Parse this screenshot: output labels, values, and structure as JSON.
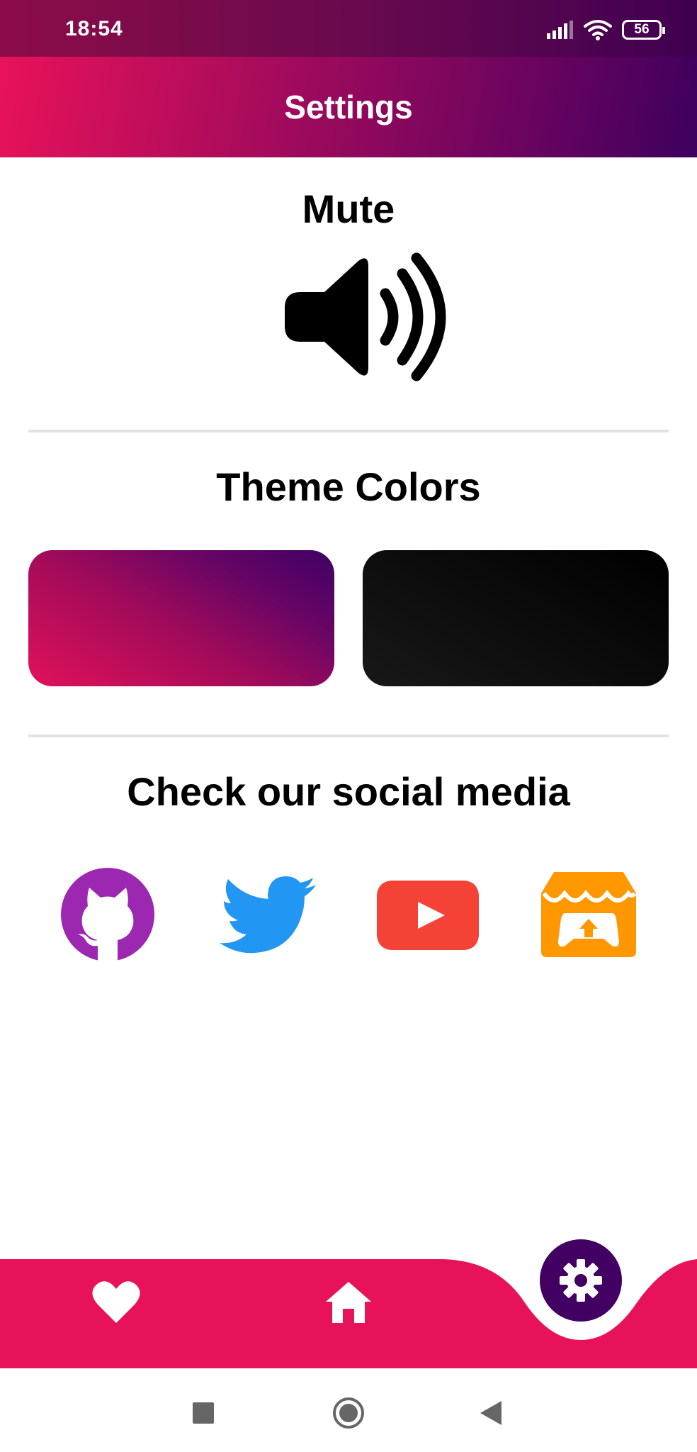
{
  "status_bar": {
    "time": "18:54",
    "battery_level": "56",
    "icons": [
      "signal-icon",
      "wifi-icon",
      "battery-icon"
    ]
  },
  "app_bar": {
    "title": "Settings"
  },
  "mute_section": {
    "title": "Mute",
    "icon": "speaker-volume-icon"
  },
  "theme_section": {
    "title": "Theme Colors",
    "swatches": [
      {
        "name": "gradient-theme",
        "colors": [
          "#e2115a",
          "#3e0065"
        ]
      },
      {
        "name": "black-theme",
        "colors": [
          "#181818",
          "#000000"
        ]
      }
    ]
  },
  "social_section": {
    "title": "Check our social media",
    "links": [
      {
        "name": "github",
        "icon": "github-icon",
        "color": "#9c27b0"
      },
      {
        "name": "twitter",
        "icon": "twitter-icon",
        "color": "#2196f3"
      },
      {
        "name": "youtube",
        "icon": "youtube-icon",
        "color": "#f44336"
      },
      {
        "name": "itchio",
        "icon": "itchio-icon",
        "color": "#ff9800"
      }
    ]
  },
  "bottom_nav": {
    "items": [
      {
        "name": "favorites",
        "icon": "heart-icon"
      },
      {
        "name": "home",
        "icon": "home-icon"
      },
      {
        "name": "settings",
        "icon": "gear-icon",
        "active": true
      }
    ],
    "bar_color": "#e8125a",
    "active_color": "#430063"
  },
  "system_nav": {
    "buttons": [
      "recents",
      "home",
      "back"
    ]
  }
}
